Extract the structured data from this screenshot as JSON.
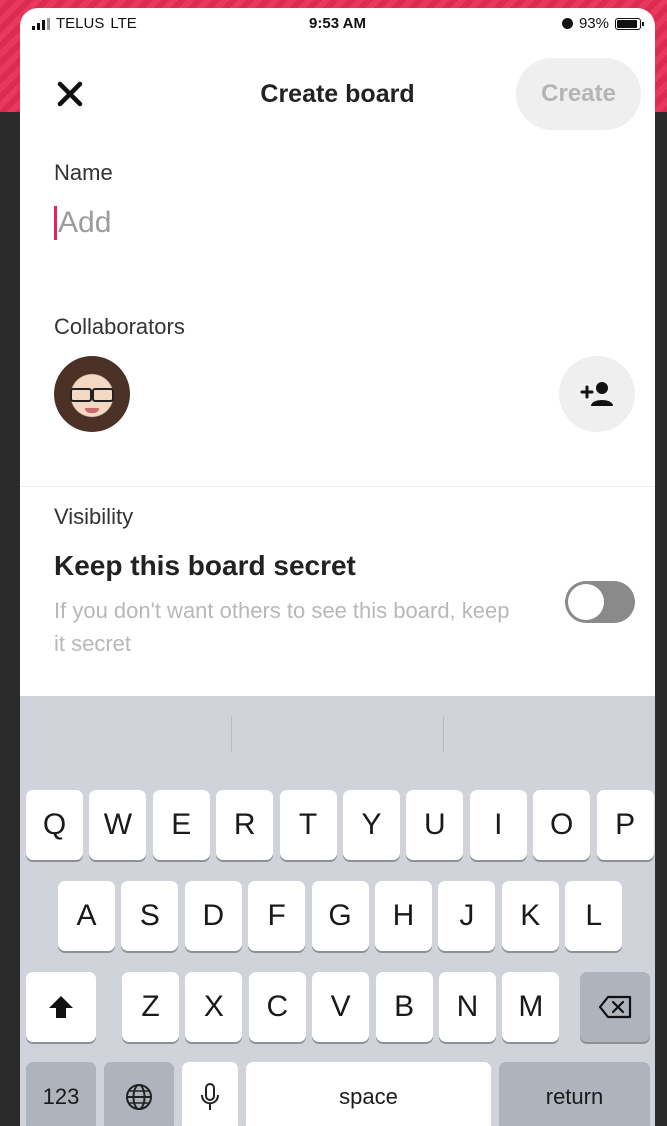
{
  "status_bar": {
    "carrier": "TELUS",
    "network": "LTE",
    "time": "9:53 AM",
    "battery": "93%",
    "battery_level": 0.93
  },
  "header": {
    "title": "Create board",
    "close_icon": "close-icon",
    "create_label": "Create"
  },
  "name_field": {
    "label": "Name",
    "placeholder": "Add",
    "value": ""
  },
  "collaborators": {
    "label": "Collaborators",
    "add_icon": "add-person-icon"
  },
  "visibility": {
    "label": "Visibility",
    "title": "Keep this board secret",
    "description": "If you don't want others to see this board, keep it secret",
    "toggle_on": false
  },
  "keyboard": {
    "row1": [
      "Q",
      "W",
      "E",
      "R",
      "T",
      "Y",
      "U",
      "I",
      "O",
      "P"
    ],
    "row2": [
      "A",
      "S",
      "D",
      "F",
      "G",
      "H",
      "J",
      "K",
      "L"
    ],
    "row3": [
      "Z",
      "X",
      "C",
      "V",
      "B",
      "N",
      "M"
    ],
    "shift_icon": "shift-icon",
    "backspace_icon": "backspace-icon",
    "numbers_label": "123",
    "globe_icon": "globe-icon",
    "mic_icon": "microphone-icon",
    "space_label": "space",
    "return_label": "return"
  },
  "colors": {
    "accent_frame": "#e8395c",
    "caret": "#e0245e",
    "toggle_off": "#8a8a8a",
    "keyboard_bg": "#d0d3da"
  }
}
